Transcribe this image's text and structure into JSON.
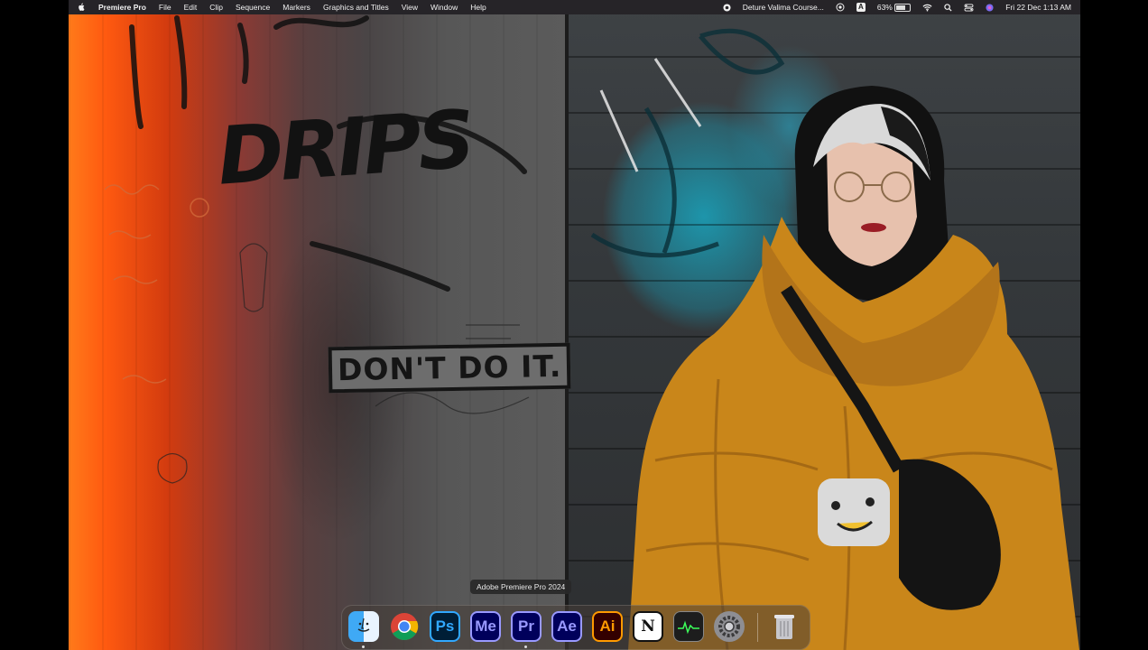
{
  "menubar": {
    "app_name": "Premiere Pro",
    "menus": [
      "File",
      "Edit",
      "Clip",
      "Sequence",
      "Markers",
      "Graphics and Titles",
      "View",
      "Window",
      "Help"
    ],
    "now_playing": "Deture Valima Course...",
    "input_source": "A",
    "battery": "63%",
    "datetime": "Fri 22 Dec  1:13 AM"
  },
  "wallpaper": {
    "graffiti_main": "DRIPS",
    "stencil": "DON'T DO IT."
  },
  "dock": {
    "tooltip": "Adobe Premiere Pro 2024",
    "apps": [
      {
        "name": "Finder",
        "icon": "finder-icon"
      },
      {
        "name": "Google Chrome",
        "icon": "chrome-icon"
      },
      {
        "name": "Photoshop",
        "label": "Ps"
      },
      {
        "name": "Media Encoder",
        "label": "Me"
      },
      {
        "name": "Premiere Pro",
        "label": "Pr"
      },
      {
        "name": "After Effects",
        "label": "Ae"
      },
      {
        "name": "Illustrator",
        "label": "Ai"
      },
      {
        "name": "Notion",
        "label": "N"
      },
      {
        "name": "Activity Monitor",
        "icon": "activity-monitor-icon"
      },
      {
        "name": "System Settings",
        "icon": "settings-gear-icon"
      },
      {
        "name": "Trash",
        "icon": "trash-icon"
      }
    ]
  },
  "colors": {
    "menubar_bg": "#262428",
    "jacket": "#c9861a",
    "wall_teal": "#1aa0bb",
    "wall_orange": "#ff6a14"
  }
}
